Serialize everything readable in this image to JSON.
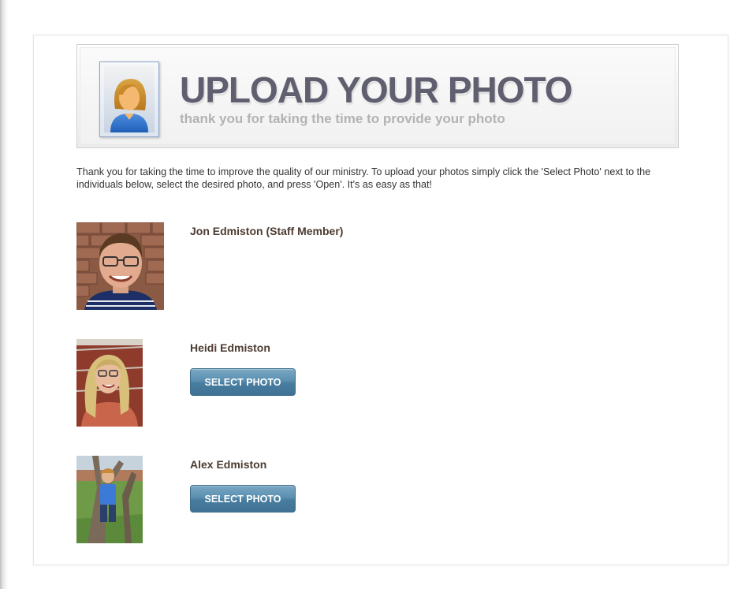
{
  "banner": {
    "title": "UPLOAD YOUR PHOTO",
    "subtitle": "thank you for taking the time to provide your photo",
    "icon": "person-portrait-icon"
  },
  "intro_text": "Thank you for taking the time to improve the quality of our ministry.  To upload your photos simply click the 'Select Photo' next to the individuals below, select the desired photo, and press 'Open'.  It's as easy as that!",
  "people": [
    {
      "name": "Jon Edmiston (Staff Member)"
    },
    {
      "name": "Heidi Edmiston",
      "button_label": "SELECT PHOTO"
    },
    {
      "name": "Alex Edmiston",
      "button_label": "SELECT PHOTO"
    }
  ],
  "colors": {
    "button": "#497d9f",
    "title": "#5f5f70",
    "name": "#4b3b30"
  }
}
